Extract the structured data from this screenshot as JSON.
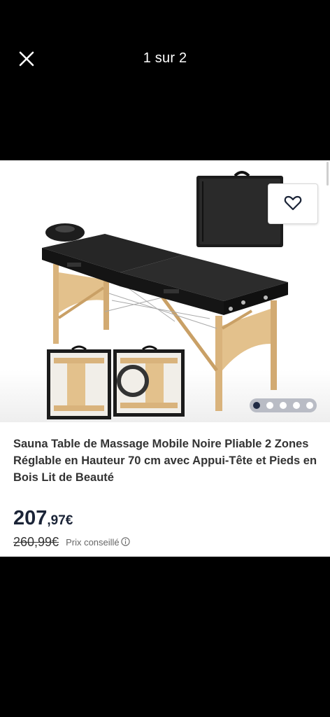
{
  "viewer": {
    "counter": "1 sur 2",
    "close_icon": "close-icon"
  },
  "product": {
    "title": "Sauna Table de Massage Mobile Noire Pliable 2 Zones Réglable en Hauteur 70 cm avec Appui-Tête et Pieds en Bois Lit de Beauté",
    "price_integer": "207",
    "price_decimal": ",97€",
    "price_old": "260,99€",
    "price_note": "Prix conseillé",
    "favorite_icon": "heart-icon",
    "info_icon": "info-icon"
  },
  "gallery": {
    "total_dots": 5,
    "active_dot": 1
  },
  "colors": {
    "background": "#000000",
    "price": "#1b2437",
    "dots_track": "#b9bcc5",
    "active_dot": "#1f2a44"
  }
}
